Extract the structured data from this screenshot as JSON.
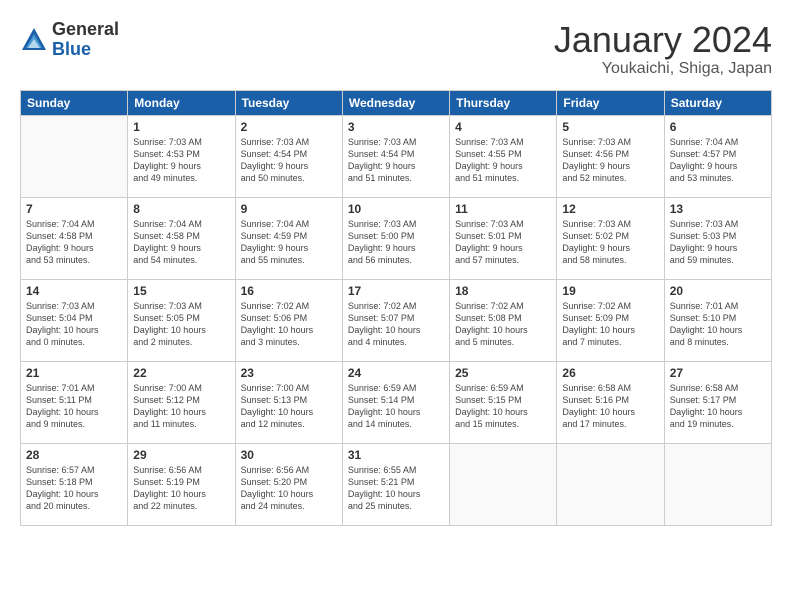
{
  "logo": {
    "general": "General",
    "blue": "Blue"
  },
  "title": "January 2024",
  "subtitle": "Youkaichi, Shiga, Japan",
  "days_of_week": [
    "Sunday",
    "Monday",
    "Tuesday",
    "Wednesday",
    "Thursday",
    "Friday",
    "Saturday"
  ],
  "weeks": [
    [
      {
        "day": "",
        "info": ""
      },
      {
        "day": "1",
        "info": "Sunrise: 7:03 AM\nSunset: 4:53 PM\nDaylight: 9 hours\nand 49 minutes."
      },
      {
        "day": "2",
        "info": "Sunrise: 7:03 AM\nSunset: 4:54 PM\nDaylight: 9 hours\nand 50 minutes."
      },
      {
        "day": "3",
        "info": "Sunrise: 7:03 AM\nSunset: 4:54 PM\nDaylight: 9 hours\nand 51 minutes."
      },
      {
        "day": "4",
        "info": "Sunrise: 7:03 AM\nSunset: 4:55 PM\nDaylight: 9 hours\nand 51 minutes."
      },
      {
        "day": "5",
        "info": "Sunrise: 7:03 AM\nSunset: 4:56 PM\nDaylight: 9 hours\nand 52 minutes."
      },
      {
        "day": "6",
        "info": "Sunrise: 7:04 AM\nSunset: 4:57 PM\nDaylight: 9 hours\nand 53 minutes."
      }
    ],
    [
      {
        "day": "7",
        "info": "Sunrise: 7:04 AM\nSunset: 4:58 PM\nDaylight: 9 hours\nand 53 minutes."
      },
      {
        "day": "8",
        "info": "Sunrise: 7:04 AM\nSunset: 4:58 PM\nDaylight: 9 hours\nand 54 minutes."
      },
      {
        "day": "9",
        "info": "Sunrise: 7:04 AM\nSunset: 4:59 PM\nDaylight: 9 hours\nand 55 minutes."
      },
      {
        "day": "10",
        "info": "Sunrise: 7:03 AM\nSunset: 5:00 PM\nDaylight: 9 hours\nand 56 minutes."
      },
      {
        "day": "11",
        "info": "Sunrise: 7:03 AM\nSunset: 5:01 PM\nDaylight: 9 hours\nand 57 minutes."
      },
      {
        "day": "12",
        "info": "Sunrise: 7:03 AM\nSunset: 5:02 PM\nDaylight: 9 hours\nand 58 minutes."
      },
      {
        "day": "13",
        "info": "Sunrise: 7:03 AM\nSunset: 5:03 PM\nDaylight: 9 hours\nand 59 minutes."
      }
    ],
    [
      {
        "day": "14",
        "info": "Sunrise: 7:03 AM\nSunset: 5:04 PM\nDaylight: 10 hours\nand 0 minutes."
      },
      {
        "day": "15",
        "info": "Sunrise: 7:03 AM\nSunset: 5:05 PM\nDaylight: 10 hours\nand 2 minutes."
      },
      {
        "day": "16",
        "info": "Sunrise: 7:02 AM\nSunset: 5:06 PM\nDaylight: 10 hours\nand 3 minutes."
      },
      {
        "day": "17",
        "info": "Sunrise: 7:02 AM\nSunset: 5:07 PM\nDaylight: 10 hours\nand 4 minutes."
      },
      {
        "day": "18",
        "info": "Sunrise: 7:02 AM\nSunset: 5:08 PM\nDaylight: 10 hours\nand 5 minutes."
      },
      {
        "day": "19",
        "info": "Sunrise: 7:02 AM\nSunset: 5:09 PM\nDaylight: 10 hours\nand 7 minutes."
      },
      {
        "day": "20",
        "info": "Sunrise: 7:01 AM\nSunset: 5:10 PM\nDaylight: 10 hours\nand 8 minutes."
      }
    ],
    [
      {
        "day": "21",
        "info": "Sunrise: 7:01 AM\nSunset: 5:11 PM\nDaylight: 10 hours\nand 9 minutes."
      },
      {
        "day": "22",
        "info": "Sunrise: 7:00 AM\nSunset: 5:12 PM\nDaylight: 10 hours\nand 11 minutes."
      },
      {
        "day": "23",
        "info": "Sunrise: 7:00 AM\nSunset: 5:13 PM\nDaylight: 10 hours\nand 12 minutes."
      },
      {
        "day": "24",
        "info": "Sunrise: 6:59 AM\nSunset: 5:14 PM\nDaylight: 10 hours\nand 14 minutes."
      },
      {
        "day": "25",
        "info": "Sunrise: 6:59 AM\nSunset: 5:15 PM\nDaylight: 10 hours\nand 15 minutes."
      },
      {
        "day": "26",
        "info": "Sunrise: 6:58 AM\nSunset: 5:16 PM\nDaylight: 10 hours\nand 17 minutes."
      },
      {
        "day": "27",
        "info": "Sunrise: 6:58 AM\nSunset: 5:17 PM\nDaylight: 10 hours\nand 19 minutes."
      }
    ],
    [
      {
        "day": "28",
        "info": "Sunrise: 6:57 AM\nSunset: 5:18 PM\nDaylight: 10 hours\nand 20 minutes."
      },
      {
        "day": "29",
        "info": "Sunrise: 6:56 AM\nSunset: 5:19 PM\nDaylight: 10 hours\nand 22 minutes."
      },
      {
        "day": "30",
        "info": "Sunrise: 6:56 AM\nSunset: 5:20 PM\nDaylight: 10 hours\nand 24 minutes."
      },
      {
        "day": "31",
        "info": "Sunrise: 6:55 AM\nSunset: 5:21 PM\nDaylight: 10 hours\nand 25 minutes."
      },
      {
        "day": "",
        "info": ""
      },
      {
        "day": "",
        "info": ""
      },
      {
        "day": "",
        "info": ""
      }
    ]
  ]
}
